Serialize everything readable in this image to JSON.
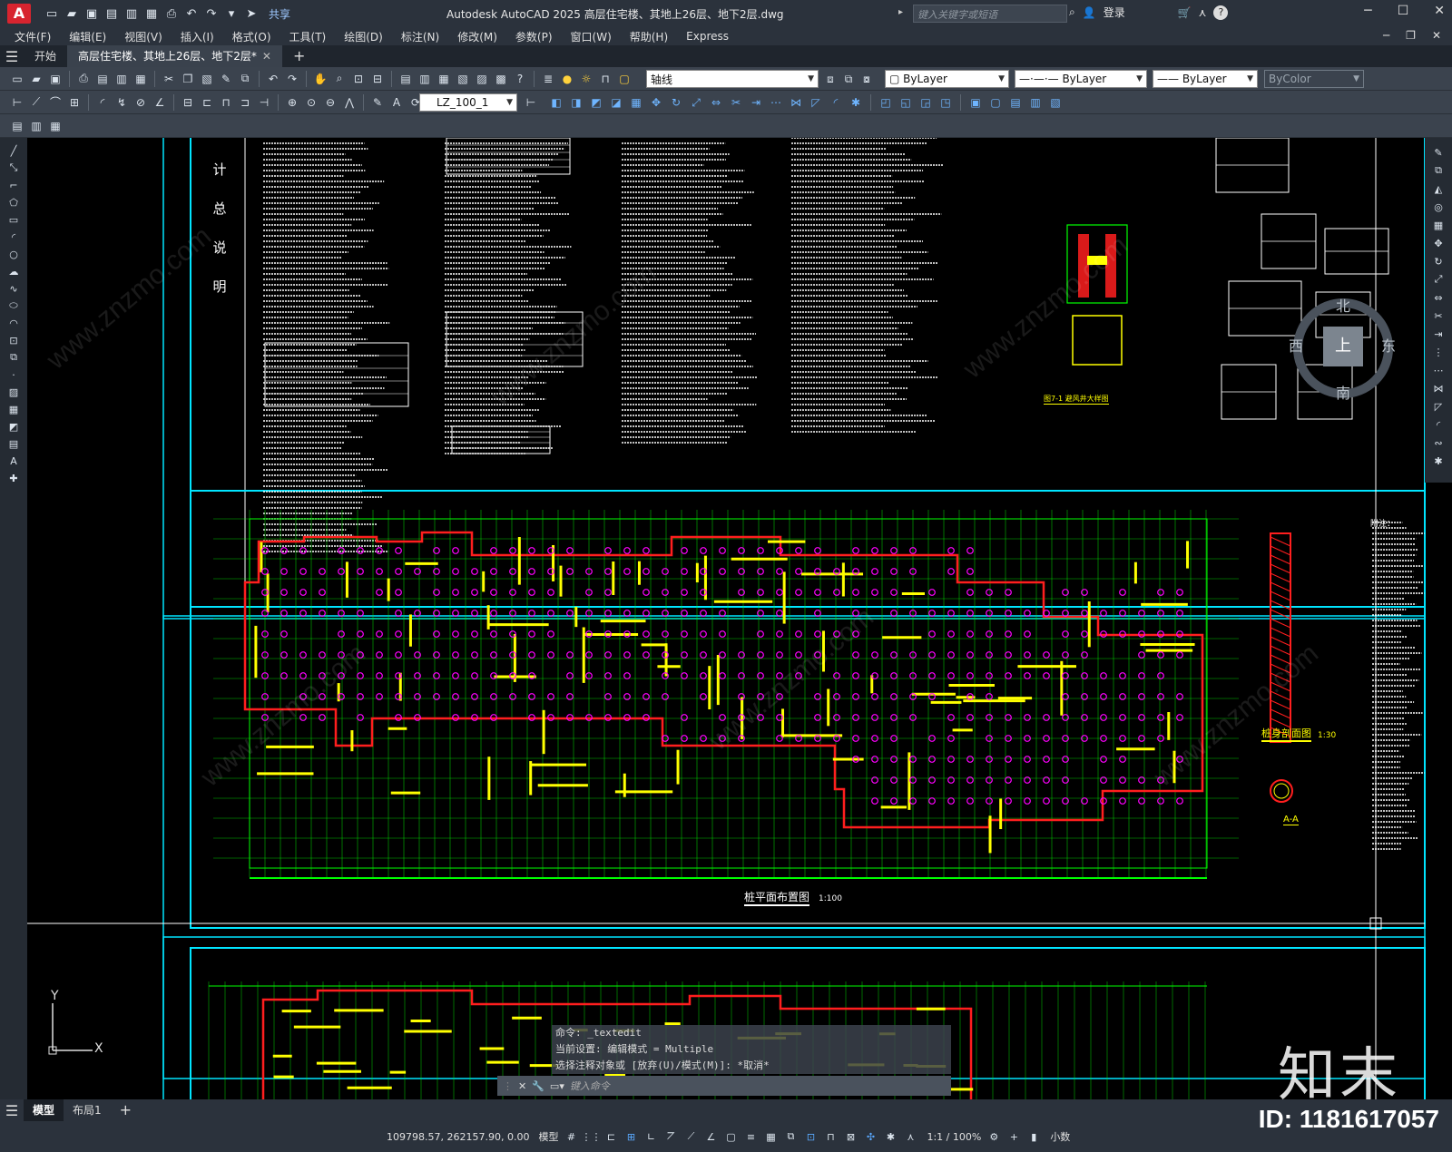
{
  "title_bar": {
    "app_name": "A",
    "share": "共享",
    "window_title": "Autodesk AutoCAD 2025    高层住宅楼、其地上26层、地下2层.dwg",
    "search_placeholder": "键入关键字或短语",
    "login": "登录"
  },
  "menu": {
    "items": [
      "文件(F)",
      "编辑(E)",
      "视图(V)",
      "插入(I)",
      "格式(O)",
      "工具(T)",
      "绘图(D)",
      "标注(N)",
      "修改(M)",
      "参数(P)",
      "窗口(W)",
      "帮助(H)",
      "Express"
    ]
  },
  "doc_tabs": {
    "start": "开始",
    "current": "高层住宅楼、其地上26层、地下2层*"
  },
  "toolbar": {
    "layer_value": "轴线",
    "color_value": "ByLayer",
    "linetype_value": "ByLayer",
    "lineweight_value": "ByLayer",
    "plotstyle_value": "ByColor",
    "dimstyle_value": "LZ_100_1"
  },
  "drawing": {
    "notes_heading": [
      "计",
      "总",
      "说",
      "明"
    ],
    "plan_title": "桩平面布置图",
    "plan_scale": "1:100",
    "pile_section_title": "桩身剖面图",
    "pile_section_scale": "1:30",
    "section_aa": "A-A",
    "detail_caption": "图7-1 避风井大样图",
    "notes_label": "附注："
  },
  "viewcube": {
    "top": "上",
    "north": "北",
    "south": "南",
    "east": "东",
    "west": "西"
  },
  "ucs": {
    "x": "X",
    "y": "Y"
  },
  "command": {
    "lines": [
      "命令: _textedit",
      "当前设置: 编辑模式 = Multiple",
      "选择注释对象或 [放弃(U)/模式(M)]: *取消*"
    ],
    "input_placeholder": "键入命令"
  },
  "layout_tabs": [
    "模型",
    "布局1"
  ],
  "status_bar": {
    "coords": "109798.57, 262157.90, 0.00",
    "model": "模型",
    "scale": "1:1 / 100%",
    "units": "小数"
  },
  "watermark": {
    "logo": "知末",
    "id": "ID: 1181617057",
    "site": "www.znzmo.com"
  },
  "colors": {
    "frame": "#00e5ff",
    "grid": "#00ff00",
    "wall": "#ffff00",
    "outline": "#ff1e1e",
    "pile": "#ff00ff"
  }
}
